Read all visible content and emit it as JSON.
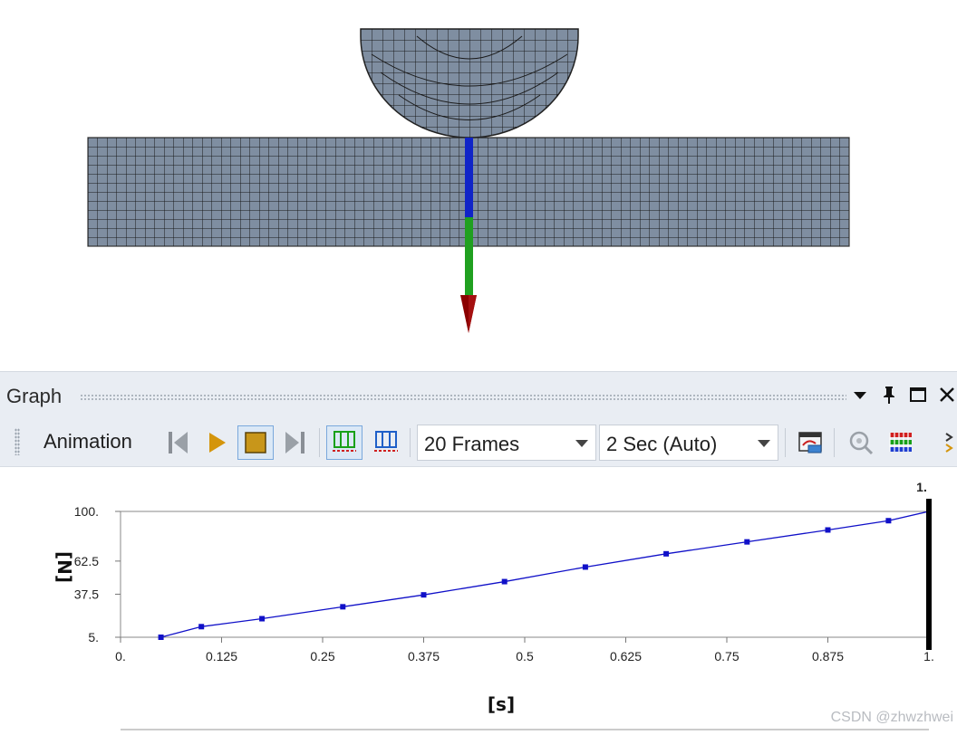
{
  "graph": {
    "title": "Graph"
  },
  "toolbar": {
    "animation_label": "Animation",
    "frames": "20 Frames",
    "duration": "2 Sec (Auto)"
  },
  "colors": {
    "mesh_fill": "#7f8ea1",
    "mesh_lines": "#1a1a1a",
    "arrow_blue": "#1024c8",
    "arrow_green": "#20a020",
    "arrow_red": "#8b0000",
    "series": "#1010c8",
    "play": "#d4950c",
    "stop": "#c8961a"
  },
  "icons": [
    "first-frame-icon",
    "play-icon",
    "stop-icon",
    "last-frame-icon",
    "distributed-frames-icon",
    "result-frames-icon",
    "export-video-icon",
    "zoom-icon",
    "color-legend-icon",
    "more-icon"
  ],
  "chart_data": {
    "type": "line",
    "xlabel": "[s]",
    "ylabel": "[N]",
    "x_ticks": [
      "0.",
      "0.125",
      "0.25",
      "0.375",
      "0.5",
      "0.625",
      "0.75",
      "0.875",
      "1."
    ],
    "y_ticks": [
      "5.",
      "37.5",
      "62.5",
      "100."
    ],
    "xlim": [
      0,
      1
    ],
    "ylim": [
      5,
      100
    ],
    "current_time_label": "1.",
    "current_time": 1,
    "series": [
      {
        "x": [
          0.05,
          0.1,
          0.175,
          0.275,
          0.375,
          0.475,
          0.575,
          0.675,
          0.775,
          0.875,
          0.95,
          1.0
        ],
        "y": [
          5,
          13,
          19,
          28,
          37,
          47,
          58,
          68,
          77,
          86,
          93,
          100
        ]
      }
    ]
  },
  "watermark": "CSDN @zhwzhwei"
}
